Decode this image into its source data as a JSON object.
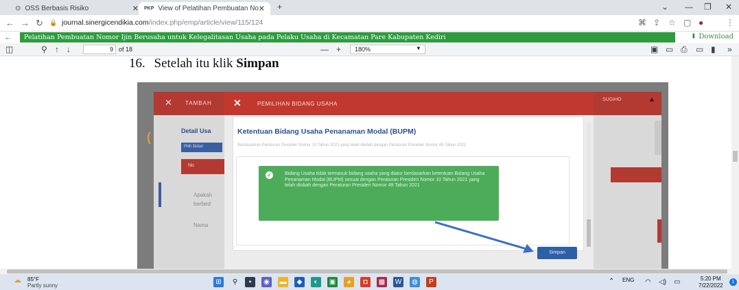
{
  "browser": {
    "tabs": [
      {
        "label": "OSS Berbasis Risiko",
        "favicon": "globe-icon"
      },
      {
        "label": "View of Pelatihan Pembuatan No",
        "favicon": "pdf-icon",
        "favicon_text": "PKP"
      }
    ],
    "new_tab": "+",
    "url_host": "journal.sinergicendikia.com",
    "url_path": "/index.php/emp/article/view/115/124"
  },
  "document": {
    "title": "Pelatihan Pembuatan Nomor Ijin Berusaha untuk Kelegalitasan Usaha pada Pelaku Usaha di Kecamatan Pare Kabupaten Kediri",
    "download_label": "Download"
  },
  "pdf_toolbar": {
    "page_current": "9",
    "page_total": "of 18",
    "zoom": "180%"
  },
  "page": {
    "step_number": "16.",
    "step_text": "Setelah itu klik",
    "step_bold": "Simpan"
  },
  "screenshot": {
    "back_header": "TAMBAH",
    "detail_label": "Detail Usa",
    "pilih_label": "Pilih Bidan",
    "row_header": "No",
    "apakah_text": "Apakah\nberbed",
    "nama_text": "Nama",
    "right_small": "SUGIHO",
    "modal_title": "PEMILIHAN BIDANG USAHA",
    "card_title": "Ketentuan Bidang Usaha Penanaman Modal (BUPM)",
    "card_subtitle": "Berdasarkan Peraturan Presiden Nomor 10 Tahun 2021 yang telah diubah dengan Peraturan Presiden Nomor 49 Tahun 2021",
    "alert_text": "Bidang Usaha tidak termasuk bidang usaha yang diatur berdasarkan ketentuan Bidang Usaha Penanaman Modal (BUPM) sesuai dengan Peraturan Presiden Nomor 10 Tahun 2021 yang telah diubah dengan Peraturan Presiden Nomor 49 Tahun 2021",
    "save_button": "Simpan"
  },
  "taskbar": {
    "temperature": "85°F",
    "weather": "Partly sunny",
    "language": "ENG",
    "time": "5:20 PM",
    "date": "7/22/2022",
    "notifications": "1"
  }
}
